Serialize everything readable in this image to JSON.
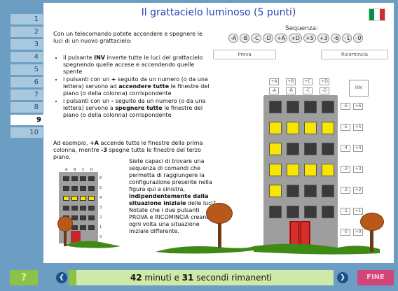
{
  "sidebar": {
    "items": [
      "1",
      "2",
      "3",
      "4",
      "5",
      "6",
      "7",
      "8",
      "9",
      "10"
    ],
    "active_index": 8
  },
  "task": {
    "title": "Il grattacielo luminoso (5 punti)",
    "intro": "Con un telecomando potete accendere e spegnere le luci di un nuovo grattacielo:",
    "bullet1_prefix": "il pulsante ",
    "bullet1_bold": "INV",
    "bullet1_suffix": " inverte tutte le luci del grattacielo spegnendo quelle accese e accendendo quelle spente",
    "bullet2_prefix": "i pulsanti con un ",
    "bullet2_sign": "+",
    "bullet2_mid": " seguito da un numero (o da una lettera) servono ad ",
    "bullet2_bold": "accendere tutte",
    "bullet2_suffix": " le finestre del piano (o della colonna) corrispondente",
    "bullet3_prefix": "i pulsanti con un ",
    "bullet3_sign": "-",
    "bullet3_mid": " seguito da un numero (o da una lettera) servono a ",
    "bullet3_bold": "spegnere tutte",
    "bullet3_suffix": " le finestre del piano (o della colonna) corrispondente",
    "example_prefix": "Ad esempio, ",
    "example_cmd1": "+A",
    "example_mid": " accende tutte le finestre della prima colonna, mentre ",
    "example_cmd2": "-3",
    "example_suffix": " spegne tutte le finestre del terzo piano.",
    "challenge_prefix": "Siete capaci di trovare una sequenza di comandi che permetta di raggiungere la configurazione presente nella figura qui a sinistra, ",
    "challenge_bold": "indipendentemente dalla situazione iniziale",
    "challenge_suffix": " delle luci? Notate che i due pulsanti PROVA e RICOMINCIA creano ogni volta una situazione iniziale differente."
  },
  "sequence": {
    "label": "Sequenza:",
    "items": [
      "-A",
      "-B",
      "-C",
      "-D",
      "+A",
      "+D",
      "+5",
      "+3",
      "-6",
      "-1",
      "-0"
    ]
  },
  "buttons": {
    "prova": "Prova",
    "ricomincia": "Ricomincia",
    "inv": "INV"
  },
  "col_buttons": {
    "plus": [
      "+A",
      "+B",
      "+C",
      "+D"
    ],
    "minus": [
      "-A",
      "-B",
      "-C",
      "-D"
    ]
  },
  "row_buttons": [
    {
      "minus": "-6",
      "plus": "+6"
    },
    {
      "minus": "-5",
      "plus": "+5"
    },
    {
      "minus": "-4",
      "plus": "+4"
    },
    {
      "minus": "-3",
      "plus": "+3"
    },
    {
      "minus": "-2",
      "plus": "+2"
    },
    {
      "minus": "-1",
      "plus": "+1"
    },
    {
      "minus": "-0",
      "plus": "+0"
    }
  ],
  "big_building": {
    "lit_color": "#f7e600",
    "dark_color": "#3a3a3a",
    "grid": [
      [
        0,
        0,
        0,
        0
      ],
      [
        1,
        1,
        1,
        1
      ],
      [
        1,
        0,
        0,
        0
      ],
      [
        1,
        1,
        1,
        1
      ],
      [
        1,
        0,
        0,
        0
      ],
      [
        0,
        0,
        0,
        0
      ]
    ]
  },
  "small_building": {
    "col_labels": [
      "A",
      "B",
      "C",
      "D"
    ],
    "row_labels": [
      "6",
      "5",
      "4",
      "3",
      "2",
      "1",
      "0"
    ],
    "grid": [
      [
        0,
        0,
        0,
        0
      ],
      [
        0,
        0,
        0,
        0
      ],
      [
        1,
        1,
        1,
        1
      ],
      [
        0,
        0,
        0,
        0
      ],
      [
        0,
        0,
        0,
        0
      ],
      [
        0,
        0,
        0,
        0
      ]
    ]
  },
  "footer": {
    "help": "?",
    "timer_minutes": "42",
    "timer_minutes_label": " minuti e ",
    "timer_seconds": "31",
    "timer_seconds_label": " secondi rimanenti",
    "finish": "FINE",
    "progress_fraction": 0.03
  },
  "colors": {
    "flag_green": "#009246",
    "flag_white": "#ffffff",
    "flag_red": "#ce2b37",
    "title_blue": "#2b3fb5"
  }
}
